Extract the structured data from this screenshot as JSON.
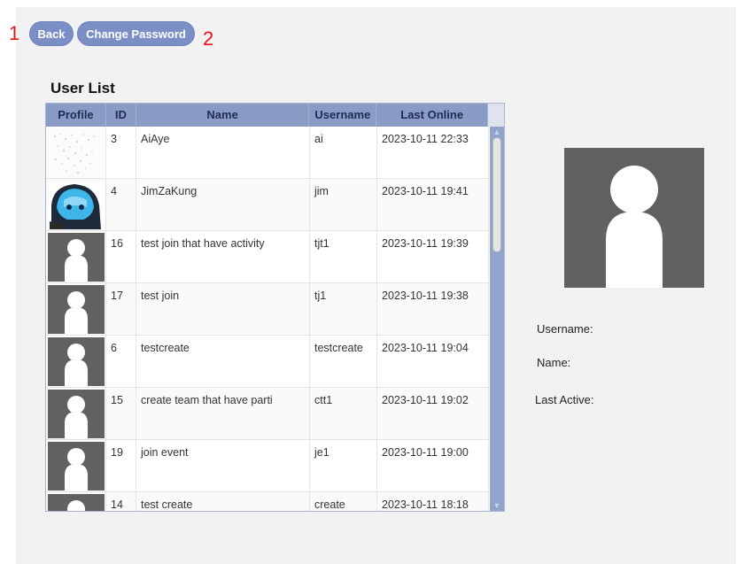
{
  "markers": [
    "1",
    "2"
  ],
  "toolbar": {
    "back_label": "Back",
    "change_password_label": "Change Password"
  },
  "user_list": {
    "title": "User List",
    "columns": [
      "Profile",
      "ID",
      "Name",
      "Username",
      "Last Online"
    ],
    "rows": [
      {
        "avatar": "noisy-image",
        "id": "3",
        "name": "AiAye",
        "username": "ai",
        "last_online": "2023-10-11 22:33"
      },
      {
        "avatar": "anime-image",
        "id": "4",
        "name": "JimZaKung",
        "username": "jim",
        "last_online": "2023-10-11 19:41"
      },
      {
        "avatar": "default-person-icon",
        "id": "16",
        "name": "test join that have activity",
        "username": "tjt1",
        "last_online": "2023-10-11 19:39"
      },
      {
        "avatar": "default-person-icon",
        "id": "17",
        "name": "test join",
        "username": "tj1",
        "last_online": "2023-10-11 19:38"
      },
      {
        "avatar": "default-person-icon",
        "id": "6",
        "name": "testcreate",
        "username": "testcreate",
        "last_online": "2023-10-11 19:04"
      },
      {
        "avatar": "default-person-icon",
        "id": "15",
        "name": "create team that have parti",
        "username": "ctt1",
        "last_online": "2023-10-11 19:02"
      },
      {
        "avatar": "default-person-icon",
        "id": "19",
        "name": "join event",
        "username": "je1",
        "last_online": "2023-10-11 19:00"
      },
      {
        "avatar": "default-person-icon",
        "id": "14",
        "name": "test create",
        "username": "create",
        "last_online": "2023-10-11 18:18"
      }
    ]
  },
  "details": {
    "avatar_icon": "default-person-icon",
    "username_label": "Username:",
    "name_label": "Name:",
    "last_active_label": "Last Active:"
  },
  "colors": {
    "button": "#7b8fc6",
    "header": "#8a9bc6",
    "scrollbar": "#93a4cc",
    "avatar_bg": "#616161",
    "marker": "#e8141a"
  }
}
